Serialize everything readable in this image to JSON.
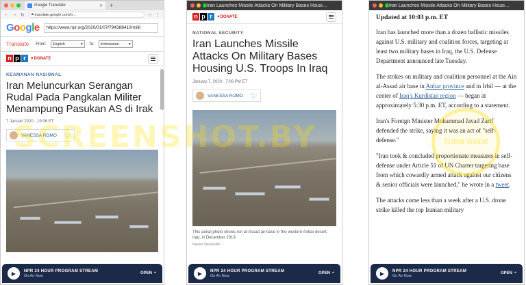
{
  "panel1": {
    "tab_title": "Google Translate",
    "address": "translate.google.com/tr...",
    "google_logo": [
      "G",
      "o",
      "o",
      "g",
      "l",
      "e"
    ],
    "translate_url": "https://www.npr.org/2020/01/07/794388410/milit",
    "translate_label": "Translate",
    "from_label": "From:",
    "from_value": "English",
    "to_label": "To:",
    "to_value": "Indonesian",
    "donate": "DONATE",
    "kicker": "KEAMANAN NASIONAL",
    "headline": "Iran Meluncurkan Serangan Rudal Pada Pangkalan Militer Menampung Pasukan AS di Irak",
    "date": "7 Januari 2020 · 19:06 ET",
    "author": "VANESSA ROMO"
  },
  "panel2": {
    "window_title": "Iran Launches Missile Attacks On Military Bases Housing U.S. Troops In Iraq",
    "donate": "DONATE",
    "kicker": "NATIONAL SECURITY",
    "headline": "Iran Launches Missile Attacks On Military Bases Housing U.S. Troops In Iraq",
    "date": "January 7, 2020 · 7:06 PM ET",
    "author": "VANESSA ROMO",
    "caption": "This aerial photo shows Ain al-Assad air base in the western Anbar desert, Iraq, in December 2019.",
    "credit": "Nasser Nasser/AP"
  },
  "panel3": {
    "window_title": "Iran Launches Missile Attacks On Military Bases Housing U.S. Troops In Iraq",
    "updated": "Updated at 10:03 p.m. ET",
    "p1": "Iran has launched more than a dozen ballistic missiles against U.S. military and coalition forces, targeting at least two military bases in Iraq, the U.S. Defense Department announced late Tuesday.",
    "p2_a": "The strikes on military and coalition personnel at the Ain al-Assad air base in ",
    "p2_link1": "Anbar province",
    "p2_b": " and in Irbil — at the center of ",
    "p2_link2": "Iraq's Kurdistan region",
    "p2_c": " — began at approximately 5:30 p.m. ET, according to a statement.",
    "p3": "Iran's Foreign Minister Mohammad Javad Zarif defended the strike, saying it was an act of \"self-defense.\"",
    "p4_a": "\"Iran took & concluded proportionate measures in self-defense under Article 51 of UN Charter targeting base from which cowardly armed attack against our citizens & senior officials were launched,\" he wrote in a ",
    "p4_link": "tweet",
    "p4_b": ".",
    "p5": "The attacks come less than a week after a U.S. drone strike killed the top Iranian military"
  },
  "audio": {
    "title": "NPR 24 HOUR PROGRAM STREAM",
    "subtitle": "On Air Now",
    "open": "OPEN"
  },
  "npr_letters": [
    "n",
    "p",
    "r"
  ],
  "watermark": "SCREENSHOT.BY",
  "seal_text": "TURN OVER"
}
